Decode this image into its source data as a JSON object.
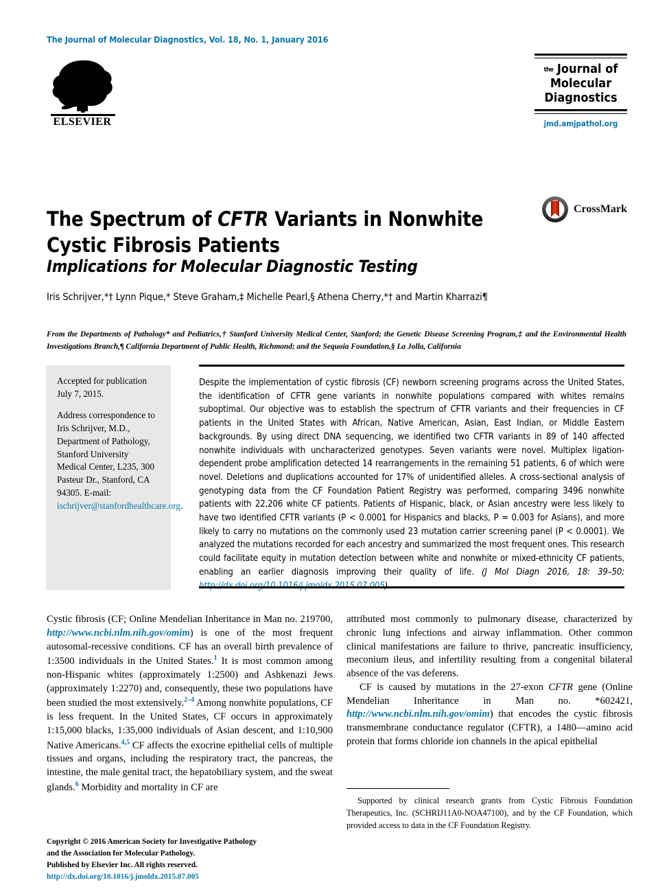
{
  "running_head": "The Journal of Molecular Diagnostics, Vol. 18, No. 1, January 2016",
  "publisher": {
    "name": "ELSEVIER",
    "logo_name": "elsevier-tree-logo"
  },
  "journal_logo": {
    "line1_small": "the",
    "line1": "Journal of",
    "line2": "Molecular",
    "line3": "Diagnostics",
    "url": "jmd.amjpathol.org"
  },
  "article": {
    "title_part1": "The Spectrum of ",
    "title_italic": "CFTR",
    "title_part2": " Variants in Nonwhite Cystic Fibrosis Patients",
    "subtitle": "Implications for Molecular Diagnostic Testing",
    "authors": "Iris Schrijver,*† Lynn Pique,* Steve Graham,‡ Michelle Pearl,§ Athena Cherry,*† and Martin Kharrazi¶",
    "affiliations": "From the Departments of Pathology* and Pediatrics,† Stanford University Medical Center, Stanford; the Genetic Disease Screening Program,‡ and the Environmental Health Investigations Branch,¶ California Department of Public Health, Richmond; and the Sequoia Foundation,§ La Jolla, California"
  },
  "crossmark": {
    "label": "CrossMark",
    "icon": "crossmark-badge-icon"
  },
  "sidebar": {
    "accepted_label": "Accepted for publication",
    "accepted_date": "July 7, 2015.",
    "correspondence": "Address correspondence to Iris Schrijver, M.D., Department of Pathology, Stanford University Medical Center, L235, 300 Pasteur Dr., Stanford, CA 94305. E-mail: ",
    "email": "ischrijver@stanfordhealthcare.org",
    "email_period": "."
  },
  "abstract": {
    "text": "Despite the implementation of cystic fibrosis (CF) newborn screening programs across the United States, the identification of CFTR gene variants in nonwhite populations compared with whites remains suboptimal. Our objective was to establish the spectrum of CFTR variants and their frequencies in CF patients in the United States with African, Native American, Asian, East Indian, or Middle Eastern backgrounds. By using direct DNA sequencing, we identified two CFTR variants in 89 of 140 affected nonwhite individuals with uncharacterized genotypes. Seven variants were novel. Multiplex ligation-dependent probe amplification detected 14 rearrangements in the remaining 51 patients, 6 of which were novel. Deletions and duplications accounted for 17% of unidentified alleles. A cross-sectional analysis of genotyping data from the CF Foundation Patient Registry was performed, comparing 3496 nonwhite patients with 22,206 white CF patients. Patients of Hispanic, black, or Asian ancestry were less likely to have two identified CFTR variants (P < 0.0001 for Hispanics and blacks, P = 0.003 for Asians), and more likely to carry no mutations on the commonly used 23 mutation carrier screening panel (P < 0.0001). We analyzed the mutations recorded for each ancestry and summarized the most frequent ones. This research could facilitate equity in mutation detection between white and nonwhite or mixed-ethnicity CF patients, enabling an earlier diagnosis improving their quality of life.",
    "citation_prefix": "(J Mol Diagn 2016, 18: 39–50; ",
    "citation_doi": "http://dx.doi.org/10.1016/j.jmoldx.2015.07.005",
    "citation_suffix": ")"
  },
  "body": {
    "left_paragraph_1": {
      "seg1": "Cystic fibrosis (CF; Online Mendelian Inheritance in Man no. 219700, ",
      "link": "http://www.ncbi.nlm.nih.gov/omim",
      "seg2": ") is one of the most frequent autosomal-recessive conditions. CF has an overall birth prevalence of 1:3500 individuals in the United States.",
      "ref1": "1",
      "seg3": " It is most common among non-Hispanic whites (approximately 1:2500) and Ashkenazi Jews (approximately 1:2270) and, consequently, these two populations have been studied the most extensively.",
      "ref2": "2–4",
      "seg4": " Among nonwhite populations, CF is less frequent. In the United States, CF occurs in approximately 1:15,000 blacks, 1:35,000 individuals of Asian descent, and 1:10,900 Native Americans.",
      "ref3": "4,5",
      "seg5": " CF affects the exocrine epithelial cells of multiple tissues and organs, including the respiratory tract, the pancreas, the intestine, the male genital tract, the hepatobiliary system, and the sweat glands.",
      "ref4": "6",
      "seg6": " Morbidity and mortality in CF are"
    },
    "right_paragraph_1": "attributed most commonly to pulmonary disease, characterized by chronic lung infections and airway inflammation. Other common clinical manifestations are failure to thrive, pancreatic insufficiency, meconium ileus, and infertility resulting from a congenital bilateral absence of the vas deferens.",
    "right_paragraph_2": {
      "seg1": "CF is caused by mutations in the 27-exon ",
      "gene": "CFTR",
      "seg2": " gene (Online Mendelian Inheritance in Man no. *602421, ",
      "link": "http://www.ncbi.nlm.nih.gov/omim",
      "seg3": ") that encodes the cystic fibrosis transmembrane conductance regulator (CFTR), a 1480—amino acid protein that forms chloride ion channels in the apical epithelial"
    }
  },
  "footnote": "Supported by clinical research grants from Cystic Fibrosis Foundation Therapeutics, Inc. (SCHRIJ11A0-NOA47100), and by the CF Foundation, which provided access to data in the CF Foundation Registry.",
  "copyright": {
    "line1": "Copyright © 2016 American Society for Investigative Pathology",
    "line2": "and the Association for Molecular Pathology.",
    "line3": "Published by Elsevier Inc. All rights reserved.",
    "doi": "http://dx.doi.org/10.1016/j.jmoldx.2015.07.005"
  },
  "colors": {
    "accent_blue": "#0c76a8",
    "sidebar_gray": "#e8e8e8"
  }
}
